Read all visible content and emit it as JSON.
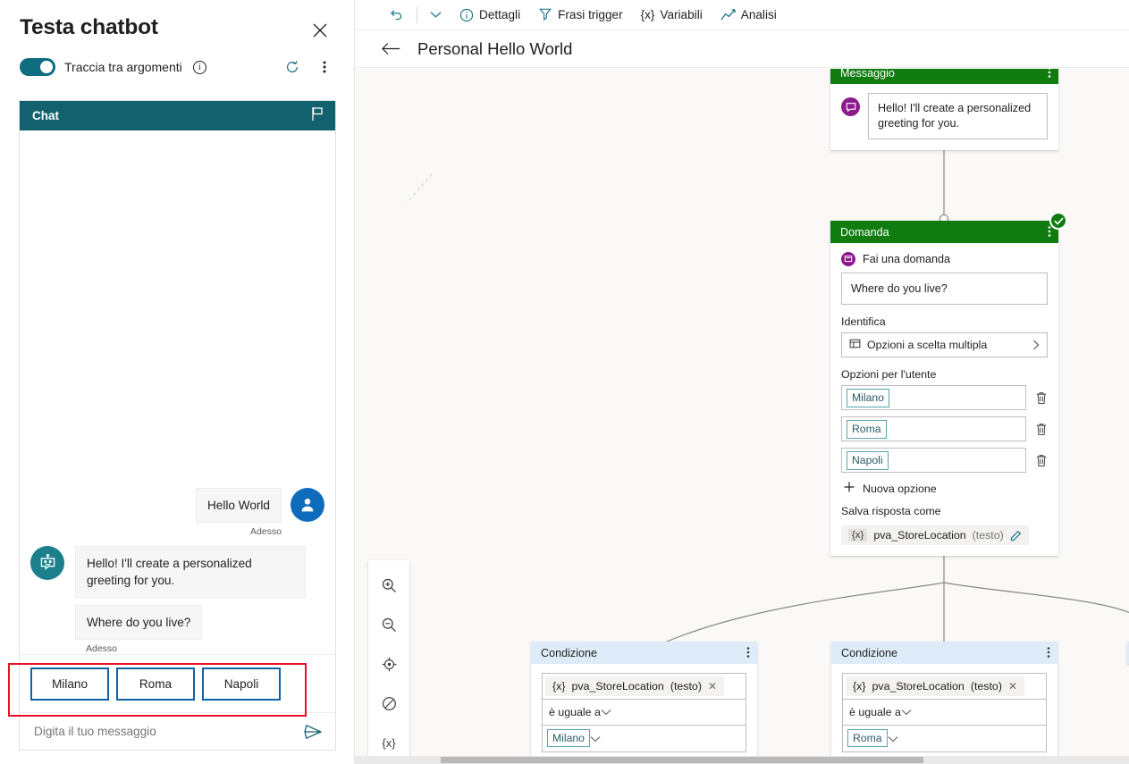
{
  "test_panel": {
    "title": "Testa chatbot",
    "close_label": "×",
    "toggle_label": "Traccia tra argomenti",
    "toggle_state": "on",
    "refresh_label": "Aggiorna",
    "more_label": "Altre opzioni",
    "chat_header": "Chat",
    "flag_label": "Segnala",
    "messages": [
      {
        "role": "user",
        "text": "Hello World",
        "time": "Adesso"
      },
      {
        "role": "bot",
        "text": "Hello! I'll create a personalized greeting for you.",
        "time": "Adesso"
      },
      {
        "role": "bot",
        "text": "Where do you live?",
        "time": "Adesso"
      }
    ],
    "suggested_actions": [
      "Milano",
      "Roma",
      "Napoli"
    ],
    "input_placeholder": "Digita il tuo messaggio",
    "input_value": "",
    "send_label": "Invia"
  },
  "command_bar": {
    "undo_label": "Annulla",
    "chevron_label": "Altro",
    "items": [
      {
        "label": "Dettagli",
        "icon": "info-icon"
      },
      {
        "label": "Frasi trigger",
        "icon": "trigger-icon"
      },
      {
        "label": "Variabili",
        "icon": "variables-icon"
      },
      {
        "label": "Analisi",
        "icon": "analytics-icon"
      }
    ]
  },
  "breadcrumb": {
    "back_label": "Indietro",
    "title": "Personal Hello World"
  },
  "canvas": {
    "nodes": [
      {
        "id": "message-node",
        "type": "Messaggio",
        "header": "Messaggio",
        "header_color": "#107c10",
        "text": "Hello! I'll create a personalized greeting for you."
      },
      {
        "id": "question-node",
        "type": "Domanda",
        "header": "Domanda",
        "header_color": "#107c10",
        "ask_label": "Fai una domanda",
        "question_text": "Where do you live?",
        "identify_label": "Identifica",
        "identify_value": "Opzioni a scelta multipla",
        "options_label": "Opzioni per l'utente",
        "options": [
          "Milano",
          "Roma",
          "Napoli"
        ],
        "new_option_label": "Nuova opzione",
        "save_label": "Salva risposta come",
        "variable_name": "pva_StoreLocation",
        "variable_type": "(testo)",
        "variable_prefix": "{x}",
        "status": "valid"
      },
      {
        "id": "condition-node-1",
        "type": "Condizione",
        "header": "Condizione",
        "header_color": "#deecf9",
        "variable_prefix": "{x}",
        "variable_name": "pva_StoreLocation",
        "variable_type": "(testo)",
        "operator": "è uguale a",
        "value": "Milano"
      },
      {
        "id": "condition-node-2",
        "type": "Condizione",
        "header": "Condizione",
        "header_color": "#deecf9",
        "variable_prefix": "{x}",
        "variable_name": "pva_StoreLocation",
        "variable_type": "(testo)",
        "operator": "è uguale a",
        "value": "Roma"
      }
    ],
    "zoom_toolbar": [
      {
        "icon": "zoom-in-icon",
        "label": "Ingrandisci"
      },
      {
        "icon": "zoom-out-icon",
        "label": "Riduci"
      },
      {
        "icon": "fit-to-screen-icon",
        "label": "Adatta allo schermo"
      },
      {
        "icon": "disable-icon",
        "label": "Disabilita"
      },
      {
        "icon": "variables-icon",
        "label": "{x}"
      }
    ]
  },
  "colors": {
    "node_green": "#107c10",
    "node_blue": "#deecf9",
    "chat_teal": "#13616e",
    "accent_blue": "#0f6cbd",
    "annotation_red": "#e81123",
    "purple_icon": "#8c1a8c",
    "canvas_bg": "#faf9f8"
  }
}
